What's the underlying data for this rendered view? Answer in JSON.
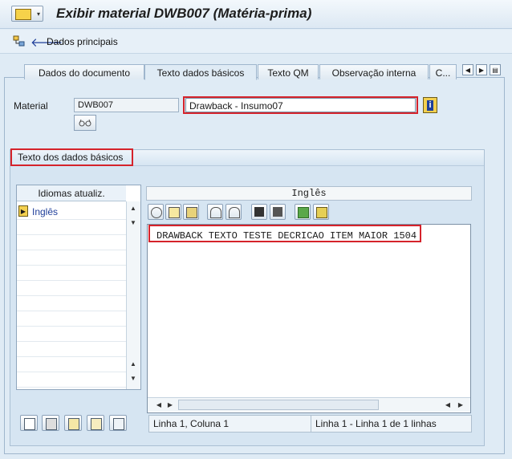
{
  "window": {
    "title": "Exibir material DWB007 (Matéria-prima)"
  },
  "toolbar": {
    "main_data_label": "Dados principais"
  },
  "tabs": [
    {
      "label": "Dados do documento"
    },
    {
      "label": "Texto dados básicos"
    },
    {
      "label": "Texto QM"
    },
    {
      "label": "Observação interna"
    },
    {
      "label": "C..."
    }
  ],
  "material": {
    "label": "Material",
    "code": "DWB007",
    "description": "Drawback - Insumo07"
  },
  "group": {
    "title": "Texto dos dados básicos"
  },
  "languages": {
    "header": "Idiomas atualiz.",
    "items": [
      "Inglês"
    ]
  },
  "editor": {
    "language_header": "Inglês",
    "text": "DRAWBACK TEXTO TESTE DECRICAO ITEM MAIOR 1504",
    "status_position": "Linha 1, Coluna 1",
    "status_lines": "Linha 1 - Linha 1 de 1 linhas"
  },
  "colors": {
    "highlight": "#d5232b",
    "background": "#dfebf5",
    "link": "#1f3f9a"
  }
}
